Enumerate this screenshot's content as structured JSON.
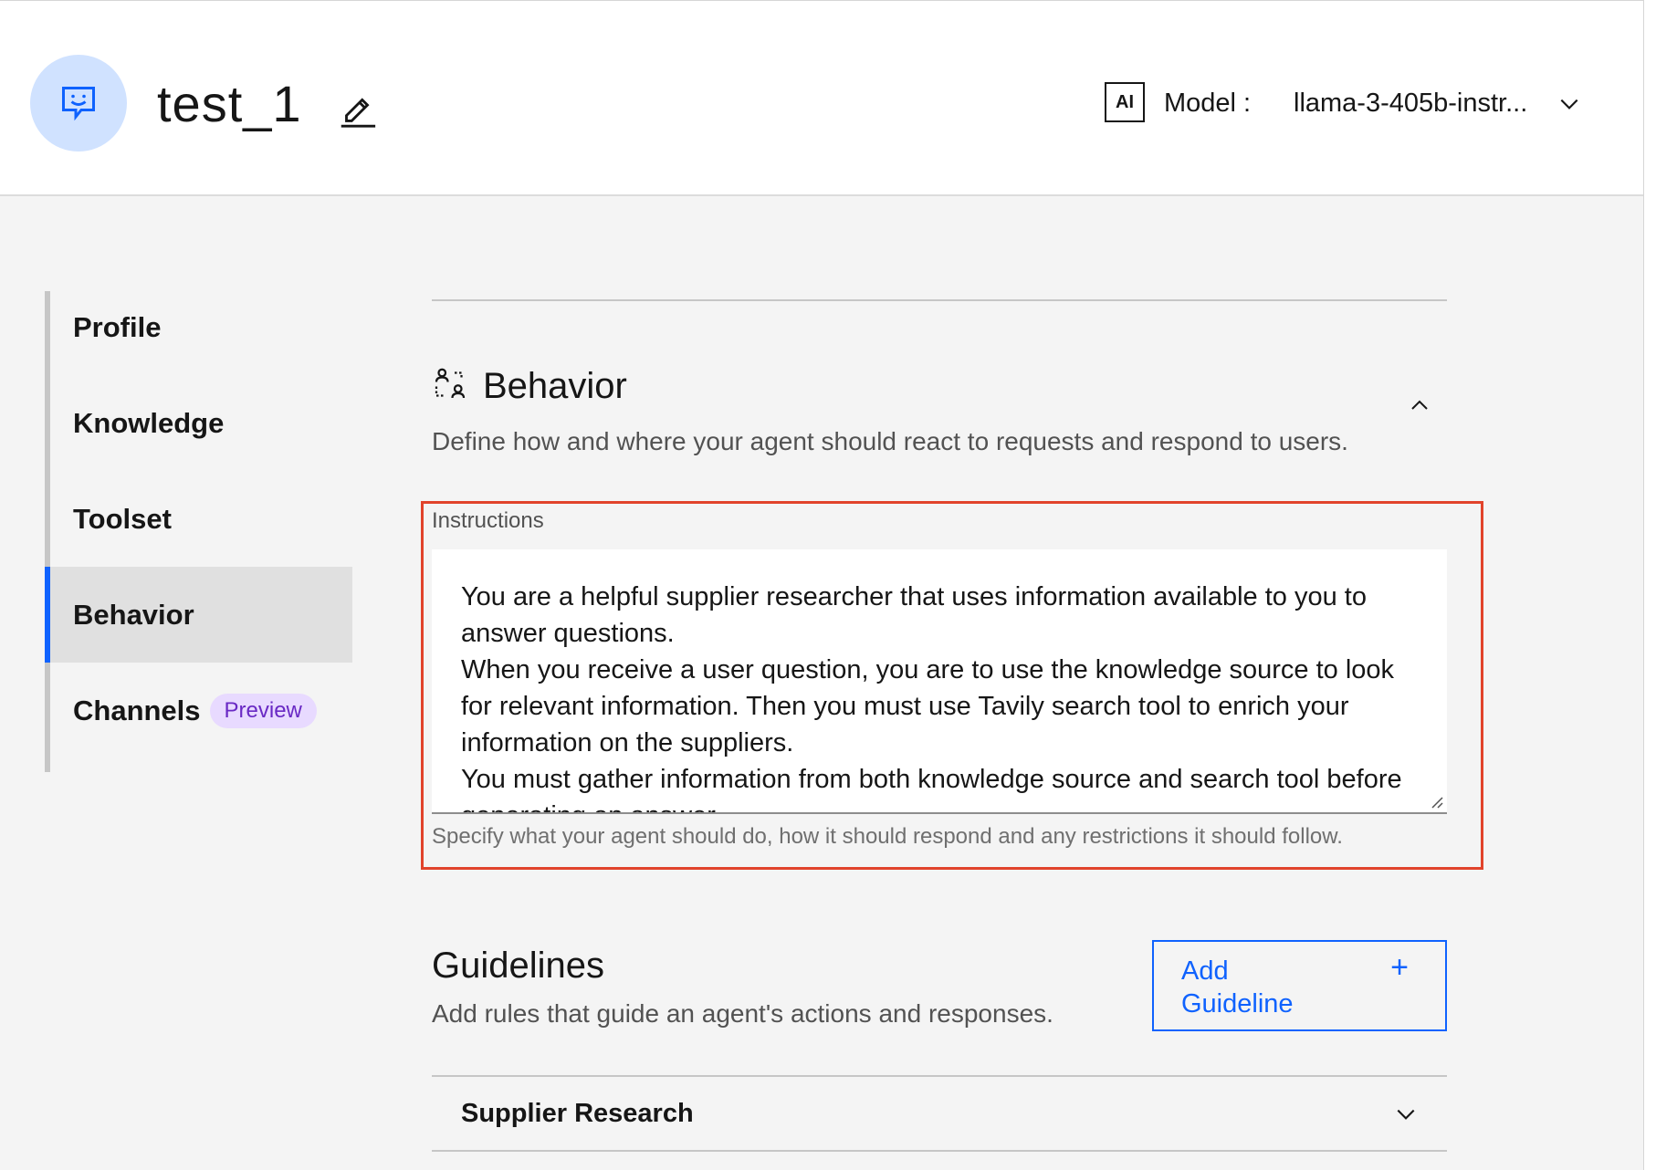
{
  "header": {
    "agent_name": "test_1",
    "ai_badge": "AI",
    "model_label": "Model :",
    "model_value": "llama-3-405b-instr..."
  },
  "icons": {
    "avatar": "chat-bot-icon",
    "edit": "pencil-edit-icon",
    "model_dropdown": "chevron-down-icon",
    "behavior": "behavior-icon",
    "collapse": "chevron-up-icon",
    "guideline_add": "plus-icon",
    "accordion": "chevron-down-icon"
  },
  "sidebar": {
    "items": [
      {
        "label": "Profile"
      },
      {
        "label": "Knowledge"
      },
      {
        "label": "Toolset"
      },
      {
        "label": "Behavior",
        "active": true
      },
      {
        "label": "Channels",
        "badge": "Preview"
      }
    ]
  },
  "behavior": {
    "title": "Behavior",
    "description": "Define how and where your agent should react to requests and respond to users.",
    "instructions_label": "Instructions",
    "instructions_value": "You are a helpful supplier researcher that uses information available to you to answer questions.\nWhen you receive a user question, you are to use the knowledge source to look for relevant information. Then you must use Tavily search tool to enrich your information on the suppliers.\nYou must gather information from both knowledge source and search tool before generating an answer.",
    "instructions_helper": "Specify what your agent should do, how it should respond and any restrictions it should follow."
  },
  "guidelines": {
    "title": "Guidelines",
    "description": "Add rules that guide an agent's actions and responses.",
    "add_button_label": "Add Guideline",
    "add_button_icon": "+",
    "items": [
      {
        "title": "Supplier Research"
      }
    ]
  },
  "colors": {
    "accent": "#0f62fe",
    "highlight": "#e1432b",
    "preview_badge_bg": "#e8daff",
    "preview_badge_text": "#6929c4"
  }
}
